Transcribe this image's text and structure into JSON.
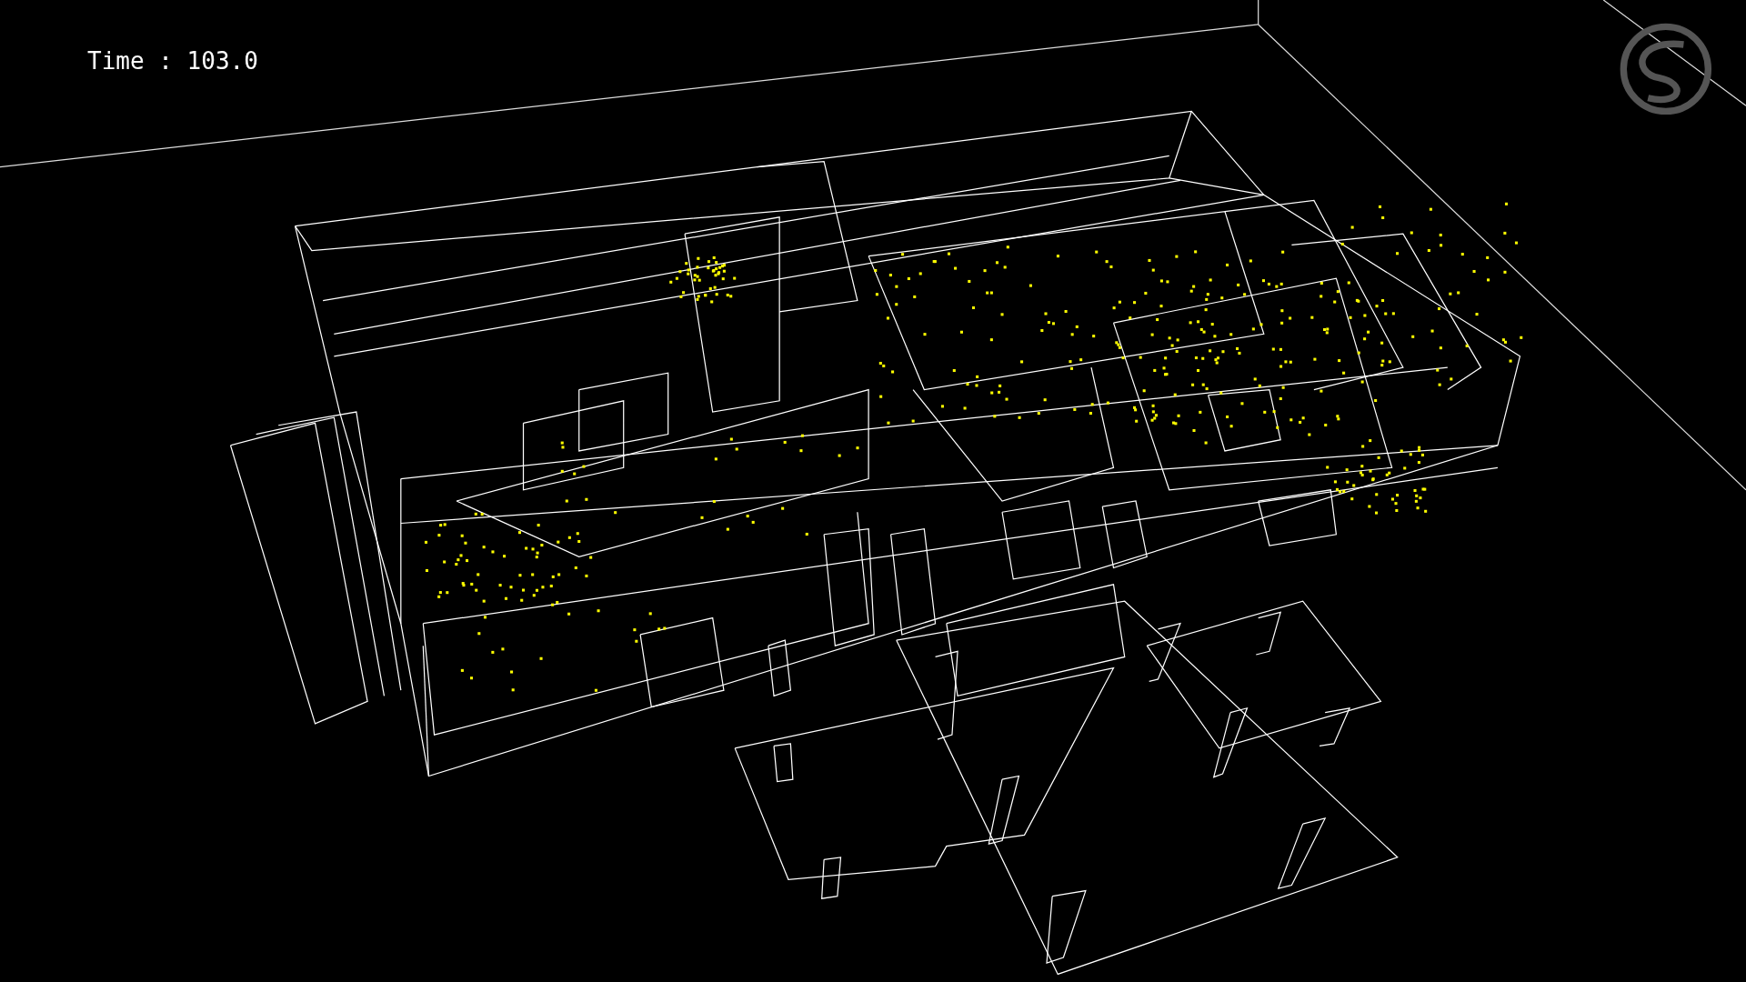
{
  "time_label": "Time : 103.0"
}
